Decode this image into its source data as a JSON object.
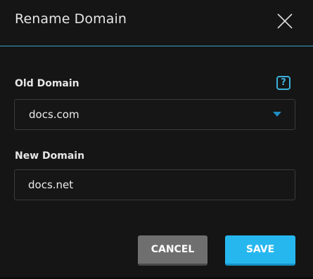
{
  "dialog": {
    "title": "Rename Domain",
    "close_icon": "close-icon"
  },
  "old_domain": {
    "label": "Old Domain",
    "help_text": "?",
    "help_icon": "help-icon",
    "selected_value": "docs.com",
    "dropdown_icon": "caret-down-icon"
  },
  "new_domain": {
    "label": "New Domain",
    "value": "docs.net"
  },
  "actions": {
    "cancel_label": "CANCEL",
    "save_label": "SAVE"
  },
  "colors": {
    "accent": "#27b7ef",
    "divider": "#3aa3c6",
    "background": "#151515",
    "cancel_button": "#6f6f6f"
  }
}
